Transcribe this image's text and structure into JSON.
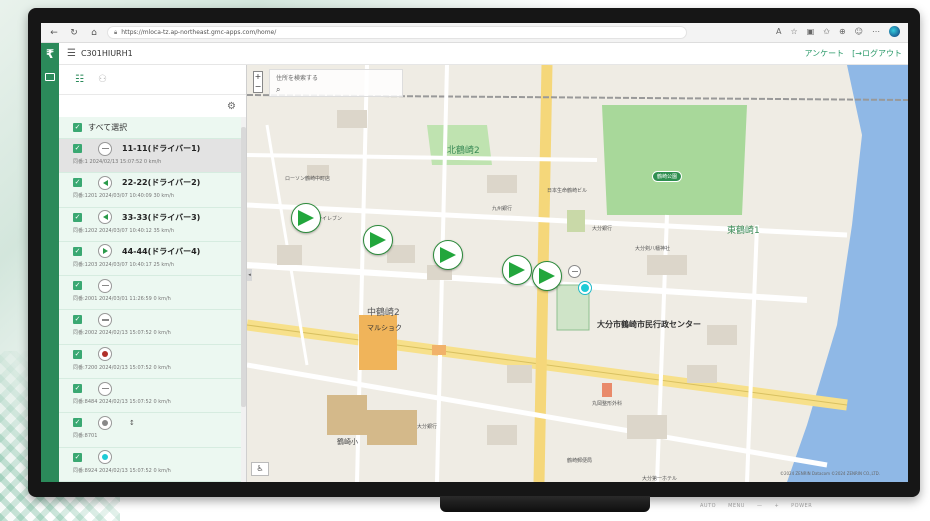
{
  "browser": {
    "url": "https://mloca-tz.ap-northeast.gmc-apps.com/home/"
  },
  "app": {
    "title": "C301HIURH1",
    "survey_label": "アンケート",
    "logout_label": "[→ログアウト"
  },
  "sidebar": {
    "select_all": "すべて選択",
    "items": [
      {
        "name": "11-11(ドライバー1)",
        "info": "同番:1   2024/02/13 15:07:52   0 km/h",
        "icon": "dash",
        "selected": true
      },
      {
        "name": "22-22(ドライバー2)",
        "info": "同番:1201   2024/03/07 10:40:09   30 km/h",
        "icon": "arrow-left"
      },
      {
        "name": "33-33(ドライバー3)",
        "info": "同番:1202   2024/03/07 10:40:12   35 km/h",
        "icon": "arrow-left"
      },
      {
        "name": "44-44(ドライバー4)",
        "info": "同番:1203   2024/03/07 10:40:17   25 km/h",
        "icon": "arrow-right"
      },
      {
        "name": "",
        "info": "同番:2001   2024/03/01 11:26:59   0 km/h",
        "icon": "dash"
      },
      {
        "name": "",
        "info": "同番:2002   2024/02/13 15:07:52   0 km/h",
        "icon": "dash"
      },
      {
        "name": "",
        "info": "同番:7200   2024/02/13 15:07:52   0 km/h",
        "icon": "dot-red"
      },
      {
        "name": "",
        "info": "同番:8484   2024/02/13 15:07:52   0 km/h",
        "icon": "dash"
      },
      {
        "name": "",
        "info": "同番:8701",
        "icon": "dot-grey",
        "extra": "↕"
      },
      {
        "name": "",
        "info": "同番:8924   2024/02/13 15:07:52   0 km/h",
        "icon": "dot-cyan"
      }
    ]
  },
  "map": {
    "search_placeholder": "住所を検索する",
    "labels": {
      "kitazaki2": "北鶴崎2",
      "park": "鶴崎公園",
      "higashi1": "東鶴崎1",
      "naka2": "中鶴崎2",
      "hall": "大分市鶴崎市民行政センター",
      "maru": "マルショク",
      "school": "鶴崎小",
      "lawson": "ローソン鶴崎中町店",
      "shrine": "大分剣八幡神社",
      "seven": "セブンイレブン",
      "kyushu": "九州銀行",
      "nittetsu": "日本生命鶴崎ビル",
      "oita": "大分銀行",
      "bank": "大分銀行",
      "hospital": "丸岡整形外科",
      "kandai": "大分第一ホテル",
      "post": "鶴崎郵便局"
    },
    "copyright": "©2024 ZENRIN Datacom ©2024 ZENRIN CO.,LTD."
  },
  "monitor": {
    "buttons": [
      "AUTO",
      "MENU",
      "—",
      "+",
      "POWER"
    ]
  },
  "colors": {
    "brand": "#2b8a5a",
    "accent": "#2b9a6a",
    "marker": "#22a63c",
    "cyan": "#1fcbd6"
  }
}
